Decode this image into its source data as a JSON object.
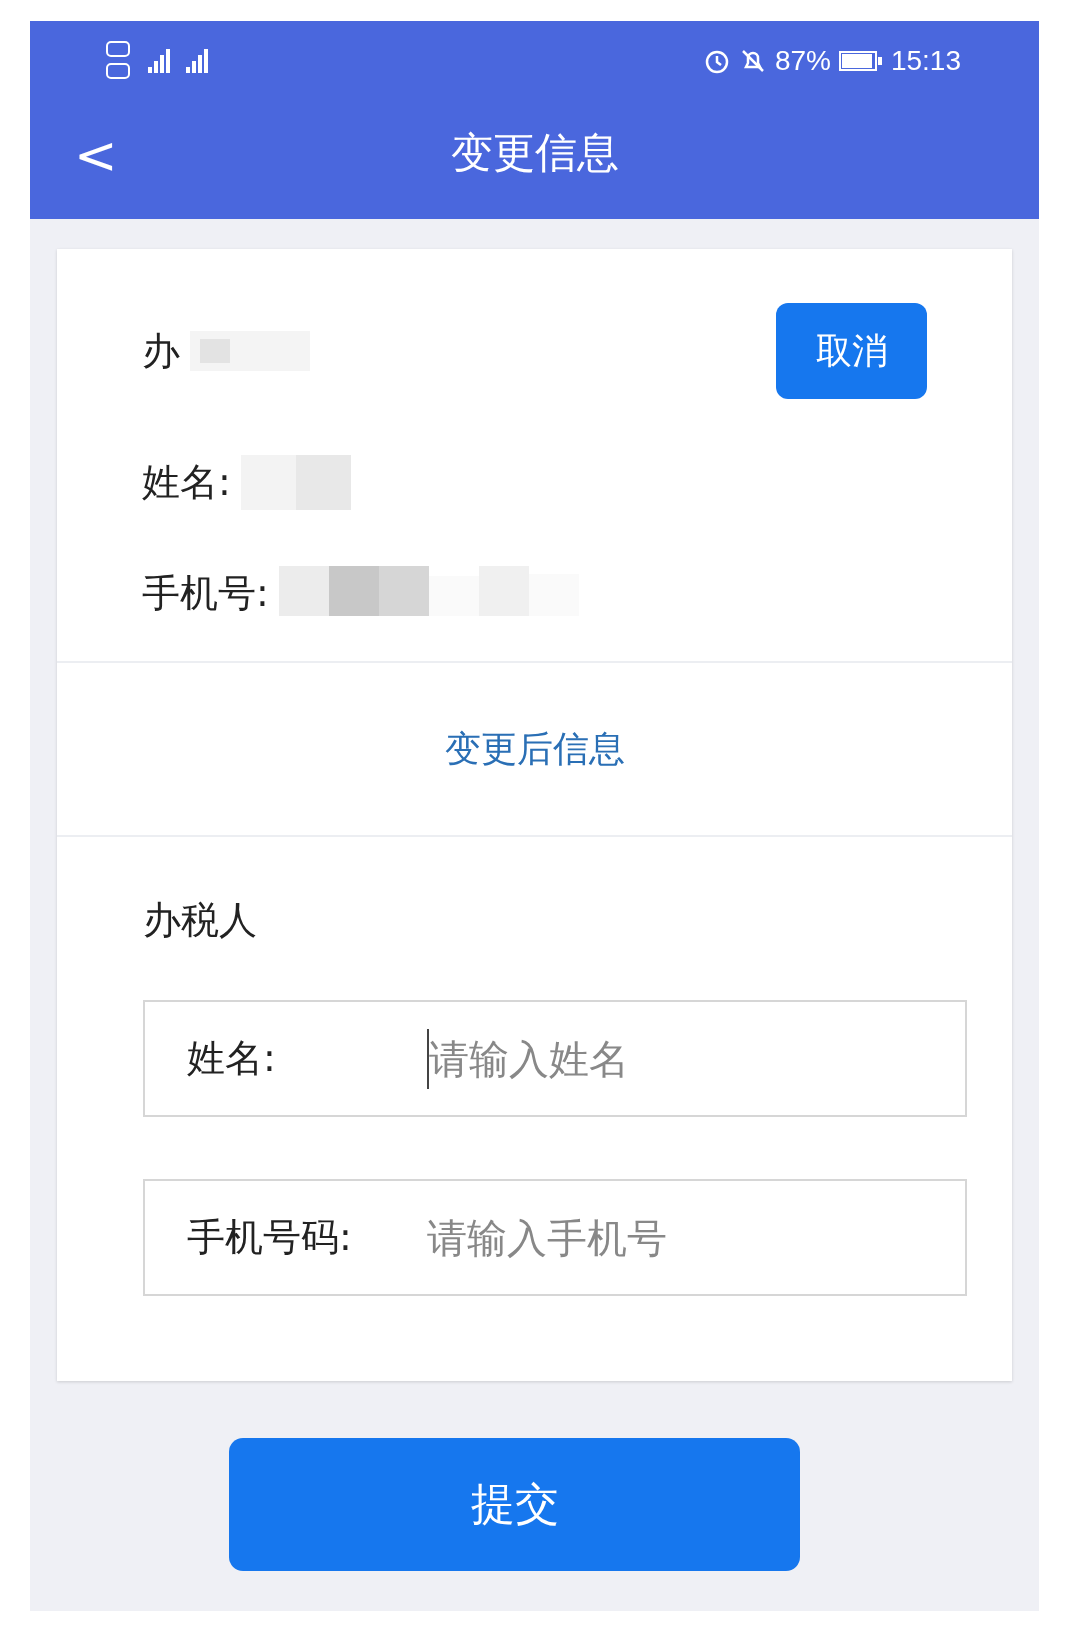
{
  "status_bar": {
    "battery_percent": "87%",
    "time": "15:13"
  },
  "header": {
    "back": "<",
    "title": "变更信息"
  },
  "current_info": {
    "title": "办",
    "cancel_button": "取消",
    "fields": [
      {
        "label": "姓名:"
      },
      {
        "label": "手机号:"
      }
    ]
  },
  "section_heading": "变更后信息",
  "new_info": {
    "title": "办税人",
    "fields": [
      {
        "label": "姓名:",
        "placeholder": "请输入姓名",
        "focused": true
      },
      {
        "label": "手机号码:",
        "placeholder": "请输入手机号",
        "focused": false
      }
    ]
  },
  "submit_button": "提交"
}
